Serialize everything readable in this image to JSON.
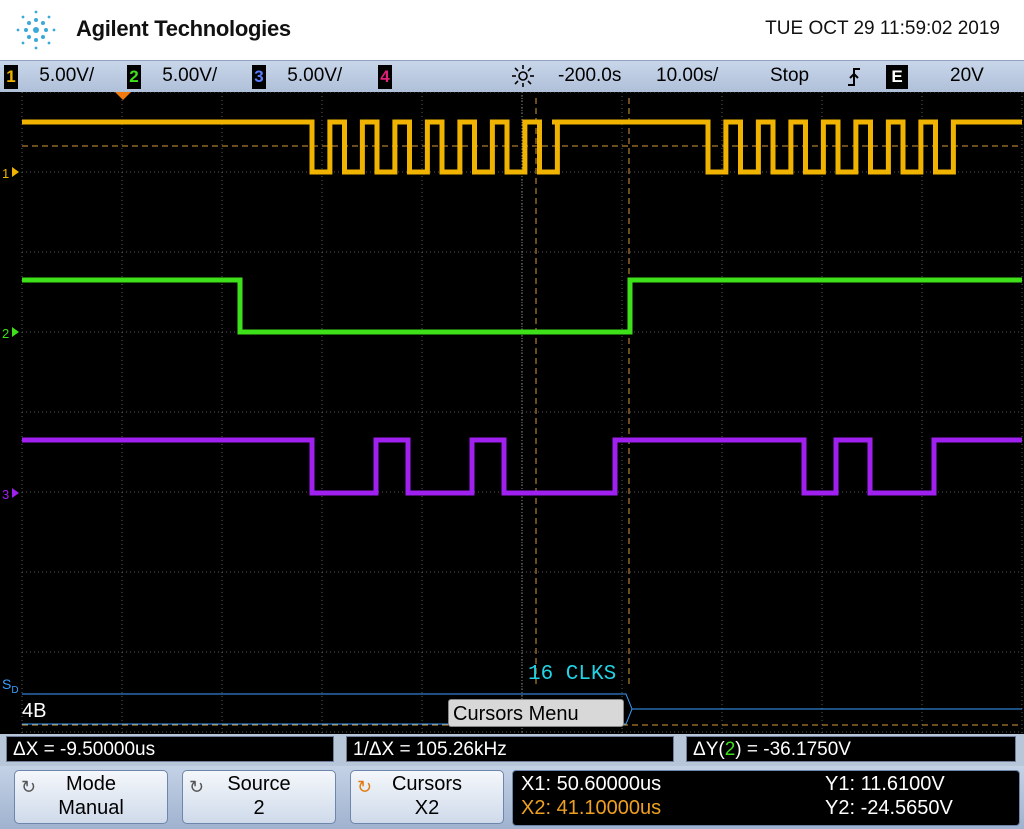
{
  "header": {
    "brand": "Agilent Technologies",
    "datetime": "TUE OCT 29 11:59:02 2019"
  },
  "status": {
    "channels": [
      {
        "num": "1",
        "scale": "5.00V/",
        "color": "#f0b400"
      },
      {
        "num": "2",
        "scale": "5.00V/",
        "color": "#3ee01a"
      },
      {
        "num": "3",
        "scale": "5.00V/",
        "color": "#5a7cff"
      },
      {
        "num": "4",
        "scale": "",
        "color": "#e0207a"
      }
    ],
    "delay": "-200.0s",
    "timebase": "10.00s/",
    "run_state": "Stop",
    "trigger_slope_icon": "rising-edge-icon",
    "trigger_source": "E",
    "trigger_level": "20V"
  },
  "screen": {
    "annotation": "16 CLKS",
    "serial_label": "S",
    "serial_sub": "D",
    "bus_value": "4B",
    "cursors_menu": "Cursors Menu",
    "ch1_marker": "1",
    "ch2_marker": "2",
    "ch3_marker": "3"
  },
  "measurements": {
    "dx": "ΔX = -9.50000us",
    "inv_dx": "1/ΔX = 105.26kHz",
    "dy_prefix": "ΔY(",
    "dy_channel": "2",
    "dy_suffix": ") = -36.1750V"
  },
  "softkeys": {
    "mode_title": "Mode",
    "mode_value": "Manual",
    "source_title": "Source",
    "source_value": "2",
    "cursors_title": "Cursors",
    "cursors_value": "X2"
  },
  "cursor_readout": {
    "x1": "X1: 50.60000us",
    "x2": "X2: 41.10000us",
    "y1": "Y1: 11.6100V",
    "y2": "Y2: -24.5650V"
  },
  "colors": {
    "ch1": "#f0b400",
    "ch2": "#3ee01a",
    "ch3": "#a020f0",
    "grid": "#5a5a5a",
    "cursor": "#d89a3a",
    "annotation": "#22d3e6",
    "x2_readout": "#f0a020"
  }
}
